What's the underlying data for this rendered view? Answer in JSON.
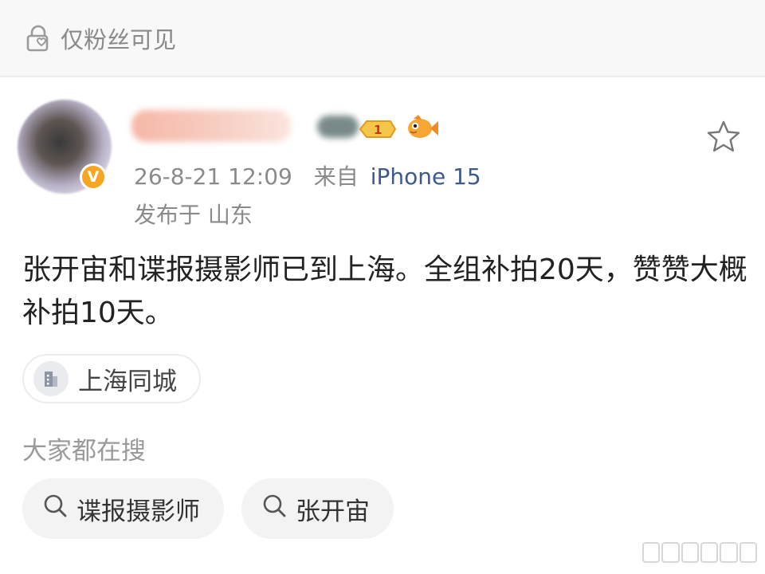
{
  "visibility": {
    "label": "仅粉丝可见",
    "icon": "lock-heart-icon"
  },
  "post": {
    "timestamp": "26-8-21 12:09",
    "source_prefix": "来自",
    "device": "iPhone 15",
    "location": "发布于 山东",
    "text": "张开宙和谍报摄影师已到上海。全组补拍20天，赞赞大概补拍10天。",
    "level_badge": "1"
  },
  "topic": {
    "label": "上海同城",
    "icon": "building-icon"
  },
  "search": {
    "section_label": "大家都在搜",
    "chips": [
      {
        "label": "谍报摄影师",
        "icon": "search-icon"
      },
      {
        "label": "张开宙",
        "icon": "search-icon"
      }
    ]
  },
  "colors": {
    "muted_text": "#8a8a8a",
    "device_link": "#3d5a8a",
    "verified_badge": "#f6a623",
    "chip_background": "#f3f3f3"
  }
}
